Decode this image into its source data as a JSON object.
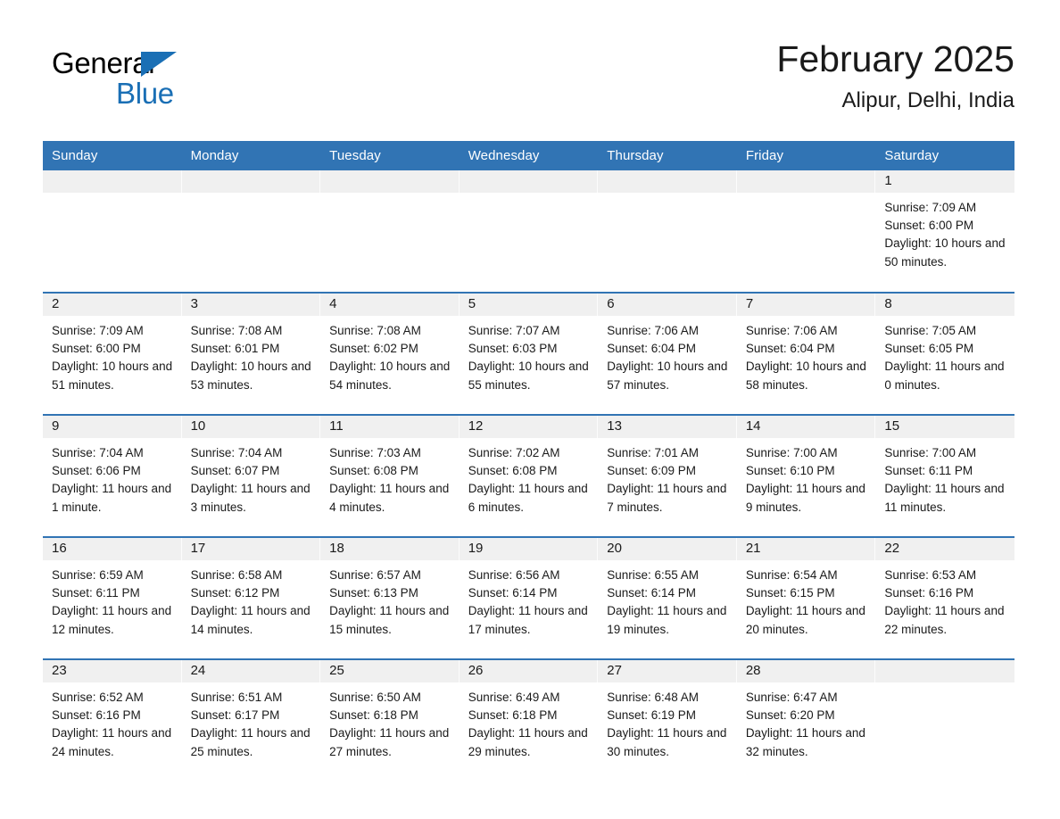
{
  "branding": {
    "logo_text_primary": "General",
    "logo_text_secondary": "Blue",
    "logo_triangle_color": "#1a6fb5"
  },
  "header": {
    "title": "February 2025",
    "location": "Alipur, Delhi, India"
  },
  "theme": {
    "header_band_color": "#3174b4",
    "daynum_band_color": "#f0f0f0",
    "row_divider_color": "#3174b4",
    "text_color": "#1a1a1a"
  },
  "weekday_headers": [
    "Sunday",
    "Monday",
    "Tuesday",
    "Wednesday",
    "Thursday",
    "Friday",
    "Saturday"
  ],
  "weeks": [
    [
      {
        "day": "",
        "sunrise": "",
        "sunset": "",
        "daylight": ""
      },
      {
        "day": "",
        "sunrise": "",
        "sunset": "",
        "daylight": ""
      },
      {
        "day": "",
        "sunrise": "",
        "sunset": "",
        "daylight": ""
      },
      {
        "day": "",
        "sunrise": "",
        "sunset": "",
        "daylight": ""
      },
      {
        "day": "",
        "sunrise": "",
        "sunset": "",
        "daylight": ""
      },
      {
        "day": "",
        "sunrise": "",
        "sunset": "",
        "daylight": ""
      },
      {
        "day": "1",
        "sunrise": "Sunrise: 7:09 AM",
        "sunset": "Sunset: 6:00 PM",
        "daylight": "Daylight: 10 hours and 50 minutes."
      }
    ],
    [
      {
        "day": "2",
        "sunrise": "Sunrise: 7:09 AM",
        "sunset": "Sunset: 6:00 PM",
        "daylight": "Daylight: 10 hours and 51 minutes."
      },
      {
        "day": "3",
        "sunrise": "Sunrise: 7:08 AM",
        "sunset": "Sunset: 6:01 PM",
        "daylight": "Daylight: 10 hours and 53 minutes."
      },
      {
        "day": "4",
        "sunrise": "Sunrise: 7:08 AM",
        "sunset": "Sunset: 6:02 PM",
        "daylight": "Daylight: 10 hours and 54 minutes."
      },
      {
        "day": "5",
        "sunrise": "Sunrise: 7:07 AM",
        "sunset": "Sunset: 6:03 PM",
        "daylight": "Daylight: 10 hours and 55 minutes."
      },
      {
        "day": "6",
        "sunrise": "Sunrise: 7:06 AM",
        "sunset": "Sunset: 6:04 PM",
        "daylight": "Daylight: 10 hours and 57 minutes."
      },
      {
        "day": "7",
        "sunrise": "Sunrise: 7:06 AM",
        "sunset": "Sunset: 6:04 PM",
        "daylight": "Daylight: 10 hours and 58 minutes."
      },
      {
        "day": "8",
        "sunrise": "Sunrise: 7:05 AM",
        "sunset": "Sunset: 6:05 PM",
        "daylight": "Daylight: 11 hours and 0 minutes."
      }
    ],
    [
      {
        "day": "9",
        "sunrise": "Sunrise: 7:04 AM",
        "sunset": "Sunset: 6:06 PM",
        "daylight": "Daylight: 11 hours and 1 minute."
      },
      {
        "day": "10",
        "sunrise": "Sunrise: 7:04 AM",
        "sunset": "Sunset: 6:07 PM",
        "daylight": "Daylight: 11 hours and 3 minutes."
      },
      {
        "day": "11",
        "sunrise": "Sunrise: 7:03 AM",
        "sunset": "Sunset: 6:08 PM",
        "daylight": "Daylight: 11 hours and 4 minutes."
      },
      {
        "day": "12",
        "sunrise": "Sunrise: 7:02 AM",
        "sunset": "Sunset: 6:08 PM",
        "daylight": "Daylight: 11 hours and 6 minutes."
      },
      {
        "day": "13",
        "sunrise": "Sunrise: 7:01 AM",
        "sunset": "Sunset: 6:09 PM",
        "daylight": "Daylight: 11 hours and 7 minutes."
      },
      {
        "day": "14",
        "sunrise": "Sunrise: 7:00 AM",
        "sunset": "Sunset: 6:10 PM",
        "daylight": "Daylight: 11 hours and 9 minutes."
      },
      {
        "day": "15",
        "sunrise": "Sunrise: 7:00 AM",
        "sunset": "Sunset: 6:11 PM",
        "daylight": "Daylight: 11 hours and 11 minutes."
      }
    ],
    [
      {
        "day": "16",
        "sunrise": "Sunrise: 6:59 AM",
        "sunset": "Sunset: 6:11 PM",
        "daylight": "Daylight: 11 hours and 12 minutes."
      },
      {
        "day": "17",
        "sunrise": "Sunrise: 6:58 AM",
        "sunset": "Sunset: 6:12 PM",
        "daylight": "Daylight: 11 hours and 14 minutes."
      },
      {
        "day": "18",
        "sunrise": "Sunrise: 6:57 AM",
        "sunset": "Sunset: 6:13 PM",
        "daylight": "Daylight: 11 hours and 15 minutes."
      },
      {
        "day": "19",
        "sunrise": "Sunrise: 6:56 AM",
        "sunset": "Sunset: 6:14 PM",
        "daylight": "Daylight: 11 hours and 17 minutes."
      },
      {
        "day": "20",
        "sunrise": "Sunrise: 6:55 AM",
        "sunset": "Sunset: 6:14 PM",
        "daylight": "Daylight: 11 hours and 19 minutes."
      },
      {
        "day": "21",
        "sunrise": "Sunrise: 6:54 AM",
        "sunset": "Sunset: 6:15 PM",
        "daylight": "Daylight: 11 hours and 20 minutes."
      },
      {
        "day": "22",
        "sunrise": "Sunrise: 6:53 AM",
        "sunset": "Sunset: 6:16 PM",
        "daylight": "Daylight: 11 hours and 22 minutes."
      }
    ],
    [
      {
        "day": "23",
        "sunrise": "Sunrise: 6:52 AM",
        "sunset": "Sunset: 6:16 PM",
        "daylight": "Daylight: 11 hours and 24 minutes."
      },
      {
        "day": "24",
        "sunrise": "Sunrise: 6:51 AM",
        "sunset": "Sunset: 6:17 PM",
        "daylight": "Daylight: 11 hours and 25 minutes."
      },
      {
        "day": "25",
        "sunrise": "Sunrise: 6:50 AM",
        "sunset": "Sunset: 6:18 PM",
        "daylight": "Daylight: 11 hours and 27 minutes."
      },
      {
        "day": "26",
        "sunrise": "Sunrise: 6:49 AM",
        "sunset": "Sunset: 6:18 PM",
        "daylight": "Daylight: 11 hours and 29 minutes."
      },
      {
        "day": "27",
        "sunrise": "Sunrise: 6:48 AM",
        "sunset": "Sunset: 6:19 PM",
        "daylight": "Daylight: 11 hours and 30 minutes."
      },
      {
        "day": "28",
        "sunrise": "Sunrise: 6:47 AM",
        "sunset": "Sunset: 6:20 PM",
        "daylight": "Daylight: 11 hours and 32 minutes."
      },
      {
        "day": "",
        "sunrise": "",
        "sunset": "",
        "daylight": ""
      }
    ]
  ]
}
